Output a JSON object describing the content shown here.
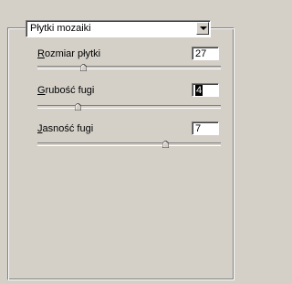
{
  "dropdown": {
    "selected": "Płytki mozaiki"
  },
  "fields": [
    {
      "label_ul": "R",
      "label_rest": "ozmiar płytki",
      "value": "27",
      "slider": 0.27
    },
    {
      "label_ul": "G",
      "label_rest": "rubość fugi",
      "value": "4",
      "slider": 0.2
    },
    {
      "label_ul": "J",
      "label_rest": "asność fugi",
      "value": "7",
      "slider": 0.7
    }
  ]
}
